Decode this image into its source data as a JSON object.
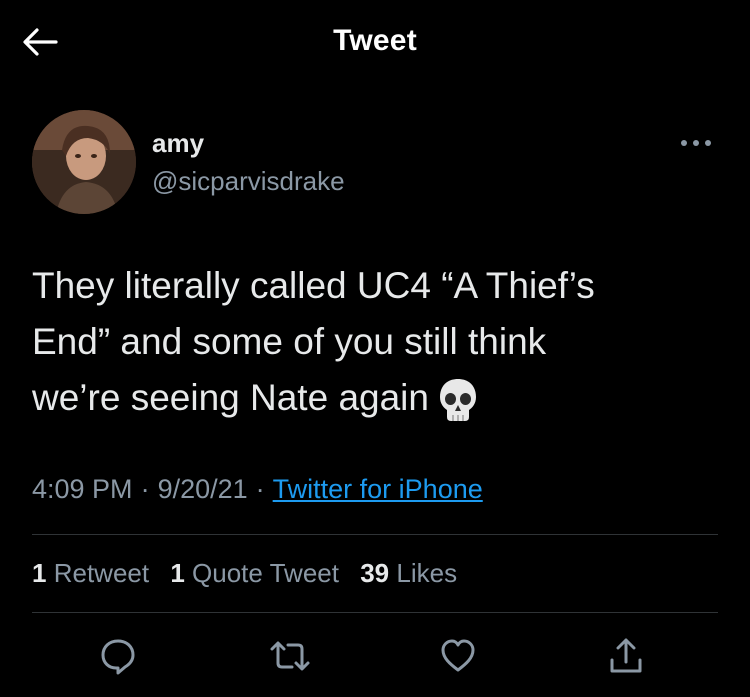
{
  "header": {
    "title": "Tweet",
    "back_icon": "arrow-left-icon"
  },
  "author": {
    "name": "amy",
    "handle": "@sicparvisdrake",
    "more_icon": "more-horizontal-icon"
  },
  "tweet": {
    "text": "They literally called UC4 “A Thief’s\nEnd” and some of you still think\nwe’re seeing Nate again",
    "emoji": "skull-emoji"
  },
  "meta": {
    "time": "4:09 PM",
    "date": "9/20/21",
    "separator": "·",
    "source": "Twitter for iPhone"
  },
  "stats": {
    "retweets_count": "1",
    "retweets_label": "Retweet",
    "quotes_count": "1",
    "quotes_label": "Quote Tweet",
    "likes_count": "39",
    "likes_label": "Likes"
  },
  "actions": [
    "reply-icon",
    "retweet-icon",
    "like-icon",
    "share-icon"
  ],
  "colors": {
    "background": "#000000",
    "text": "#e7e9ea",
    "secondary": "#8b98a5",
    "link": "#1d9bf0",
    "divider": "#2f3336"
  }
}
